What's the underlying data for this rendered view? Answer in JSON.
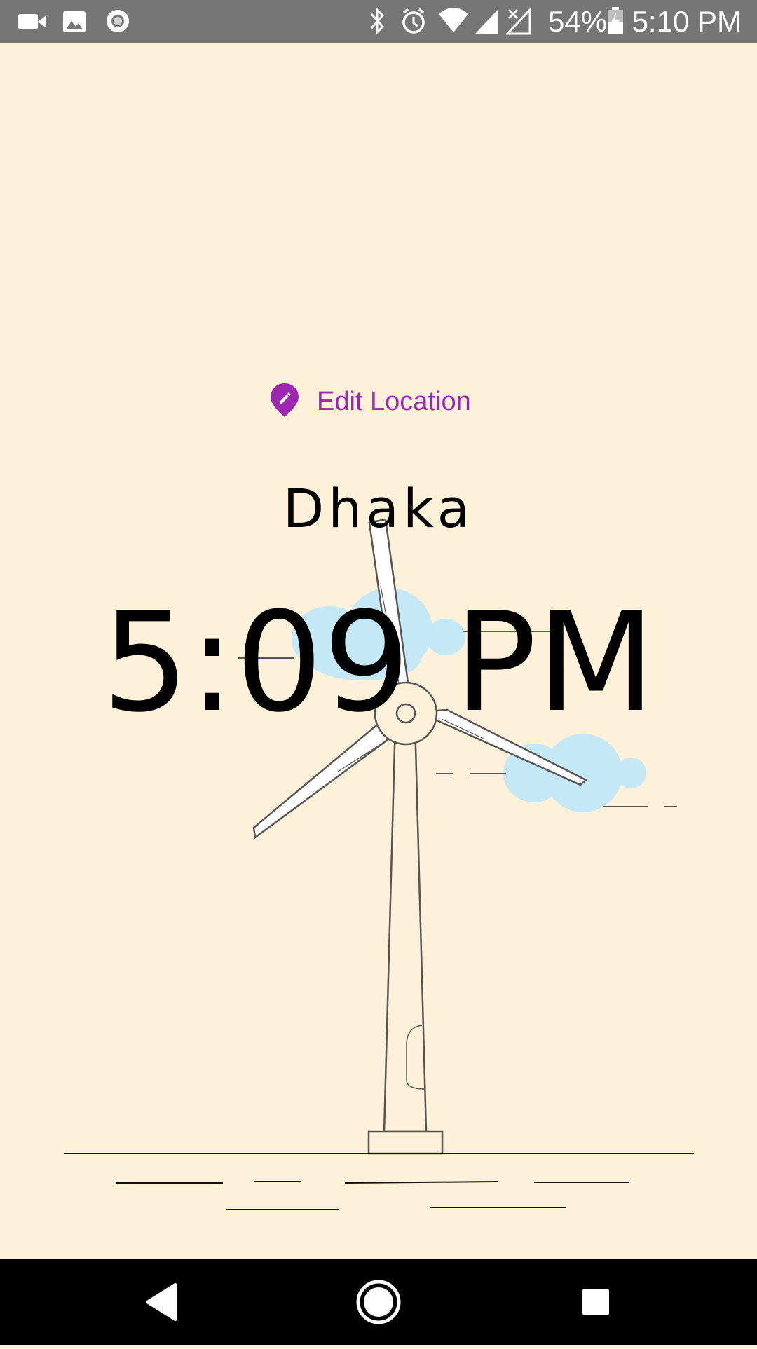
{
  "status_bar": {
    "left_icons": [
      "video-camera-icon",
      "image-icon",
      "record-icon"
    ],
    "right_icons": [
      "bluetooth-icon",
      "alarm-icon",
      "wifi-icon",
      "signal-icon",
      "signal-no-sim-icon",
      "battery-charging-icon"
    ],
    "battery_percent": "54%",
    "time": "5:10 PM",
    "background_color": "#767676"
  },
  "main": {
    "edit_location_label": "Edit Location",
    "edit_location_icon": "edit-location-pin-icon",
    "location": "Dhaka",
    "time": "5:09 PM",
    "accent_color": "#9c27b0",
    "background_color": "#fdf1d9",
    "illustration": "wind-turbine-day-illustration"
  },
  "nav_bar": {
    "buttons": [
      "back-icon",
      "home-icon",
      "recents-icon"
    ],
    "background_color": "#000000"
  }
}
